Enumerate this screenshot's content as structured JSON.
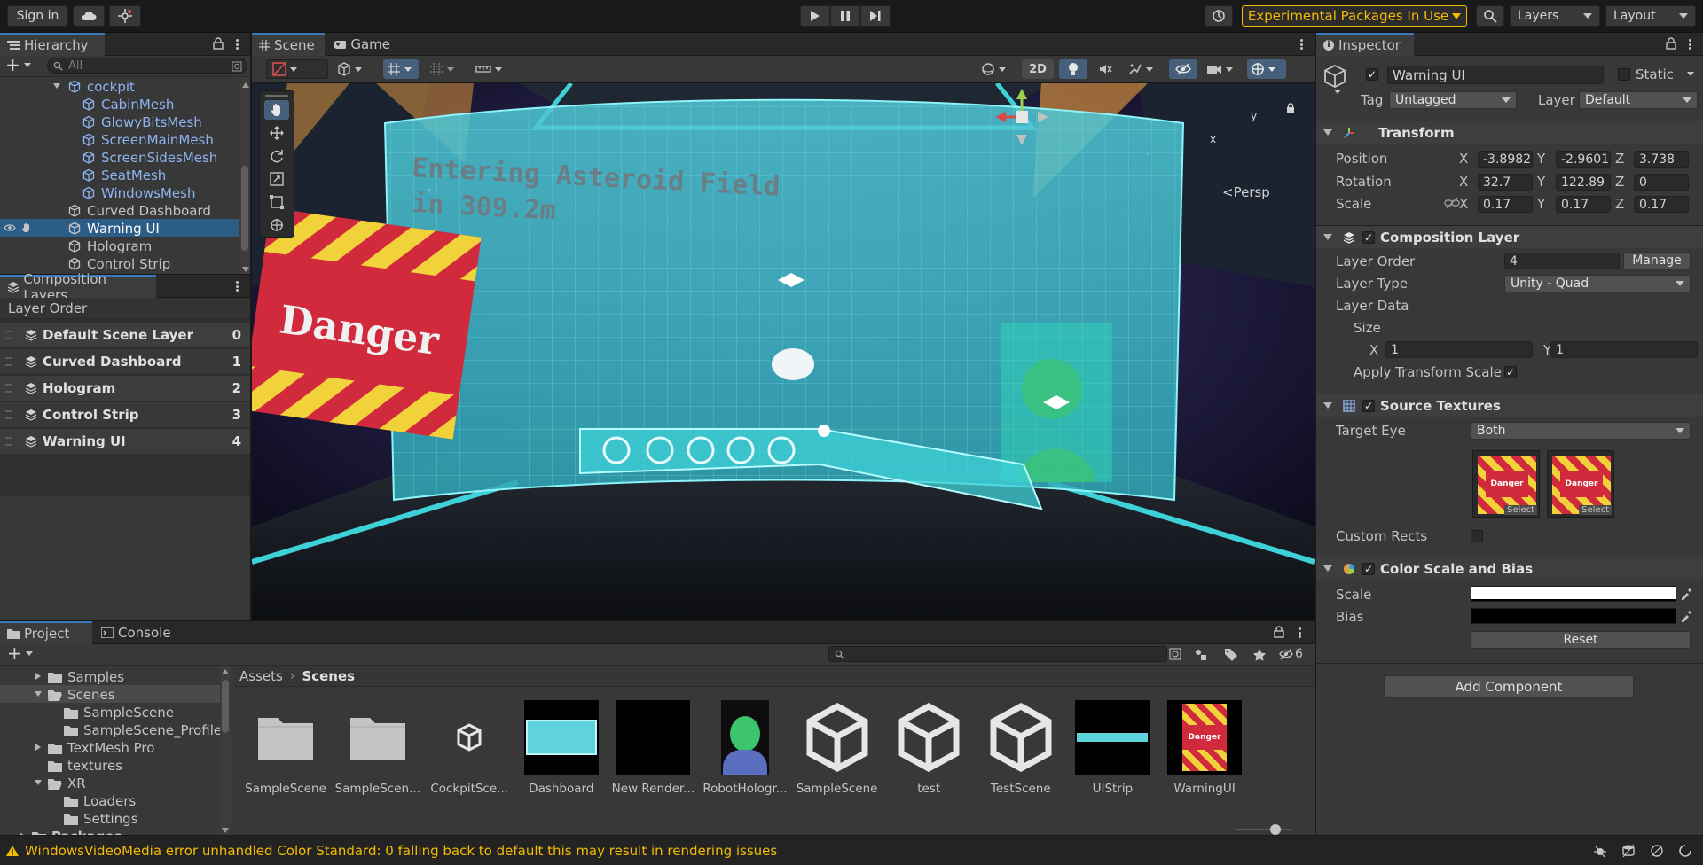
{
  "toolbar": {
    "sign_in": "Sign in",
    "experimental": "Experimental Packages In Use",
    "layers": "Layers",
    "layout": "Layout"
  },
  "hierarchy": {
    "tab": "Hierarchy",
    "search_placeholder": "All",
    "items": [
      {
        "label": "cockpit",
        "depth": 3,
        "blue": true,
        "expanded": true
      },
      {
        "label": "CabinMesh",
        "depth": 4,
        "blue": true
      },
      {
        "label": "GlowyBitsMesh",
        "depth": 4,
        "blue": true
      },
      {
        "label": "ScreenMainMesh",
        "depth": 4,
        "blue": true
      },
      {
        "label": "ScreenSidesMesh",
        "depth": 4,
        "blue": true
      },
      {
        "label": "SeatMesh",
        "depth": 4,
        "blue": true
      },
      {
        "label": "WindowsMesh",
        "depth": 4,
        "blue": true
      },
      {
        "label": "Curved Dashboard",
        "depth": 3,
        "blue": false
      },
      {
        "label": "Warning UI",
        "depth": 3,
        "blue": false,
        "selected": true
      },
      {
        "label": "Hologram",
        "depth": 3,
        "blue": false
      },
      {
        "label": "Control Strip",
        "depth": 3,
        "blue": false
      }
    ]
  },
  "composition_layers": {
    "tab": "Composition Layers",
    "header": "Layer Order",
    "layers": [
      {
        "name": "Default Scene Layer",
        "order": "0"
      },
      {
        "name": "Curved Dashboard",
        "order": "1"
      },
      {
        "name": "Hologram",
        "order": "2"
      },
      {
        "name": "Control Strip",
        "order": "3"
      },
      {
        "name": "Warning UI",
        "order": "4"
      }
    ]
  },
  "scene": {
    "tab_scene": "Scene",
    "tab_game": "Game",
    "btn_2d": "2D",
    "persp": "<Persp",
    "gizmo_x": "x",
    "gizmo_y": "y",
    "overlay_text_line1": "Entering Asteroid Field",
    "overlay_text_line2": "in 309.2m",
    "danger_text": "Danger"
  },
  "inspector": {
    "tab": "Inspector",
    "object_name": "Warning UI",
    "static_label": "Static",
    "tag_label": "Tag",
    "tag_value": "Untagged",
    "layer_label": "Layer",
    "layer_value": "Default",
    "transform": {
      "title": "Transform",
      "position_label": "Position",
      "pos": [
        "-3.8982",
        "-2.9601",
        "3.738"
      ],
      "rotation_label": "Rotation",
      "rot": [
        "32.7",
        "122.89",
        "0"
      ],
      "scale_label": "Scale",
      "scale": [
        "0.17",
        "0.17",
        "0.17"
      ],
      "x": "X",
      "y": "Y",
      "z": "Z"
    },
    "composition_layer": {
      "title": "Composition Layer",
      "layer_order_label": "Layer Order",
      "layer_order": "4",
      "manage": "Manage",
      "layer_type_label": "Layer Type",
      "layer_type": "Unity - Quad",
      "layer_data_label": "Layer Data",
      "size_label": "Size",
      "size_x": "1",
      "size_y": "1",
      "apply_transform_scale": "Apply Transform Scale"
    },
    "source_textures": {
      "title": "Source Textures",
      "target_eye_label": "Target Eye",
      "target_eye": "Both",
      "select": "Select",
      "custom_rects": "Custom Rects"
    },
    "color_scale_bias": {
      "title": "Color Scale and Bias",
      "scale_label": "Scale",
      "bias_label": "Bias",
      "reset": "Reset"
    },
    "add_component": "Add Component"
  },
  "project": {
    "tab_project": "Project",
    "tab_console": "Console",
    "hidden_count": "6",
    "breadcrumb_root": "Assets",
    "breadcrumb_current": "Scenes",
    "tree": [
      {
        "label": "Samples",
        "depth": 1,
        "arrow": "right"
      },
      {
        "label": "Scenes",
        "depth": 1,
        "arrow": "down",
        "selected": true,
        "open": true
      },
      {
        "label": "SampleScene",
        "depth": 2,
        "arrow": "none"
      },
      {
        "label": "SampleScene_Profiles",
        "depth": 2,
        "arrow": "none"
      },
      {
        "label": "TextMesh Pro",
        "depth": 1,
        "arrow": "right"
      },
      {
        "label": "textures",
        "depth": 1,
        "arrow": "none"
      },
      {
        "label": "XR",
        "depth": 1,
        "arrow": "down",
        "open": true
      },
      {
        "label": "Loaders",
        "depth": 2,
        "arrow": "none"
      },
      {
        "label": "Settings",
        "depth": 2,
        "arrow": "none"
      },
      {
        "label": "Packages",
        "depth": 0,
        "arrow": "right"
      }
    ],
    "assets": [
      {
        "label": "SampleScene",
        "kind": "folder"
      },
      {
        "label": "SampleScen...",
        "kind": "folder"
      },
      {
        "label": "CockpitSce...",
        "kind": "prefab"
      },
      {
        "label": "Dashboard",
        "kind": "dashboard"
      },
      {
        "label": "New Render...",
        "kind": "black"
      },
      {
        "label": "RobotHologr...",
        "kind": "robot"
      },
      {
        "label": "SampleScene",
        "kind": "unity"
      },
      {
        "label": "test",
        "kind": "unity"
      },
      {
        "label": "TestScene",
        "kind": "unity"
      },
      {
        "label": "UIStrip",
        "kind": "strip"
      },
      {
        "label": "WarningUI",
        "kind": "danger"
      }
    ]
  },
  "status": {
    "message": "WindowsVideoMedia error unhandled Color Standard: 0  falling back to default this may result in rendering issues"
  },
  "colors": {
    "accent": "#3a79bb",
    "selection": "#2c5d87",
    "warning": "#f4bc02",
    "teal": "#3fd1d8",
    "danger_red": "#d12a3c"
  }
}
